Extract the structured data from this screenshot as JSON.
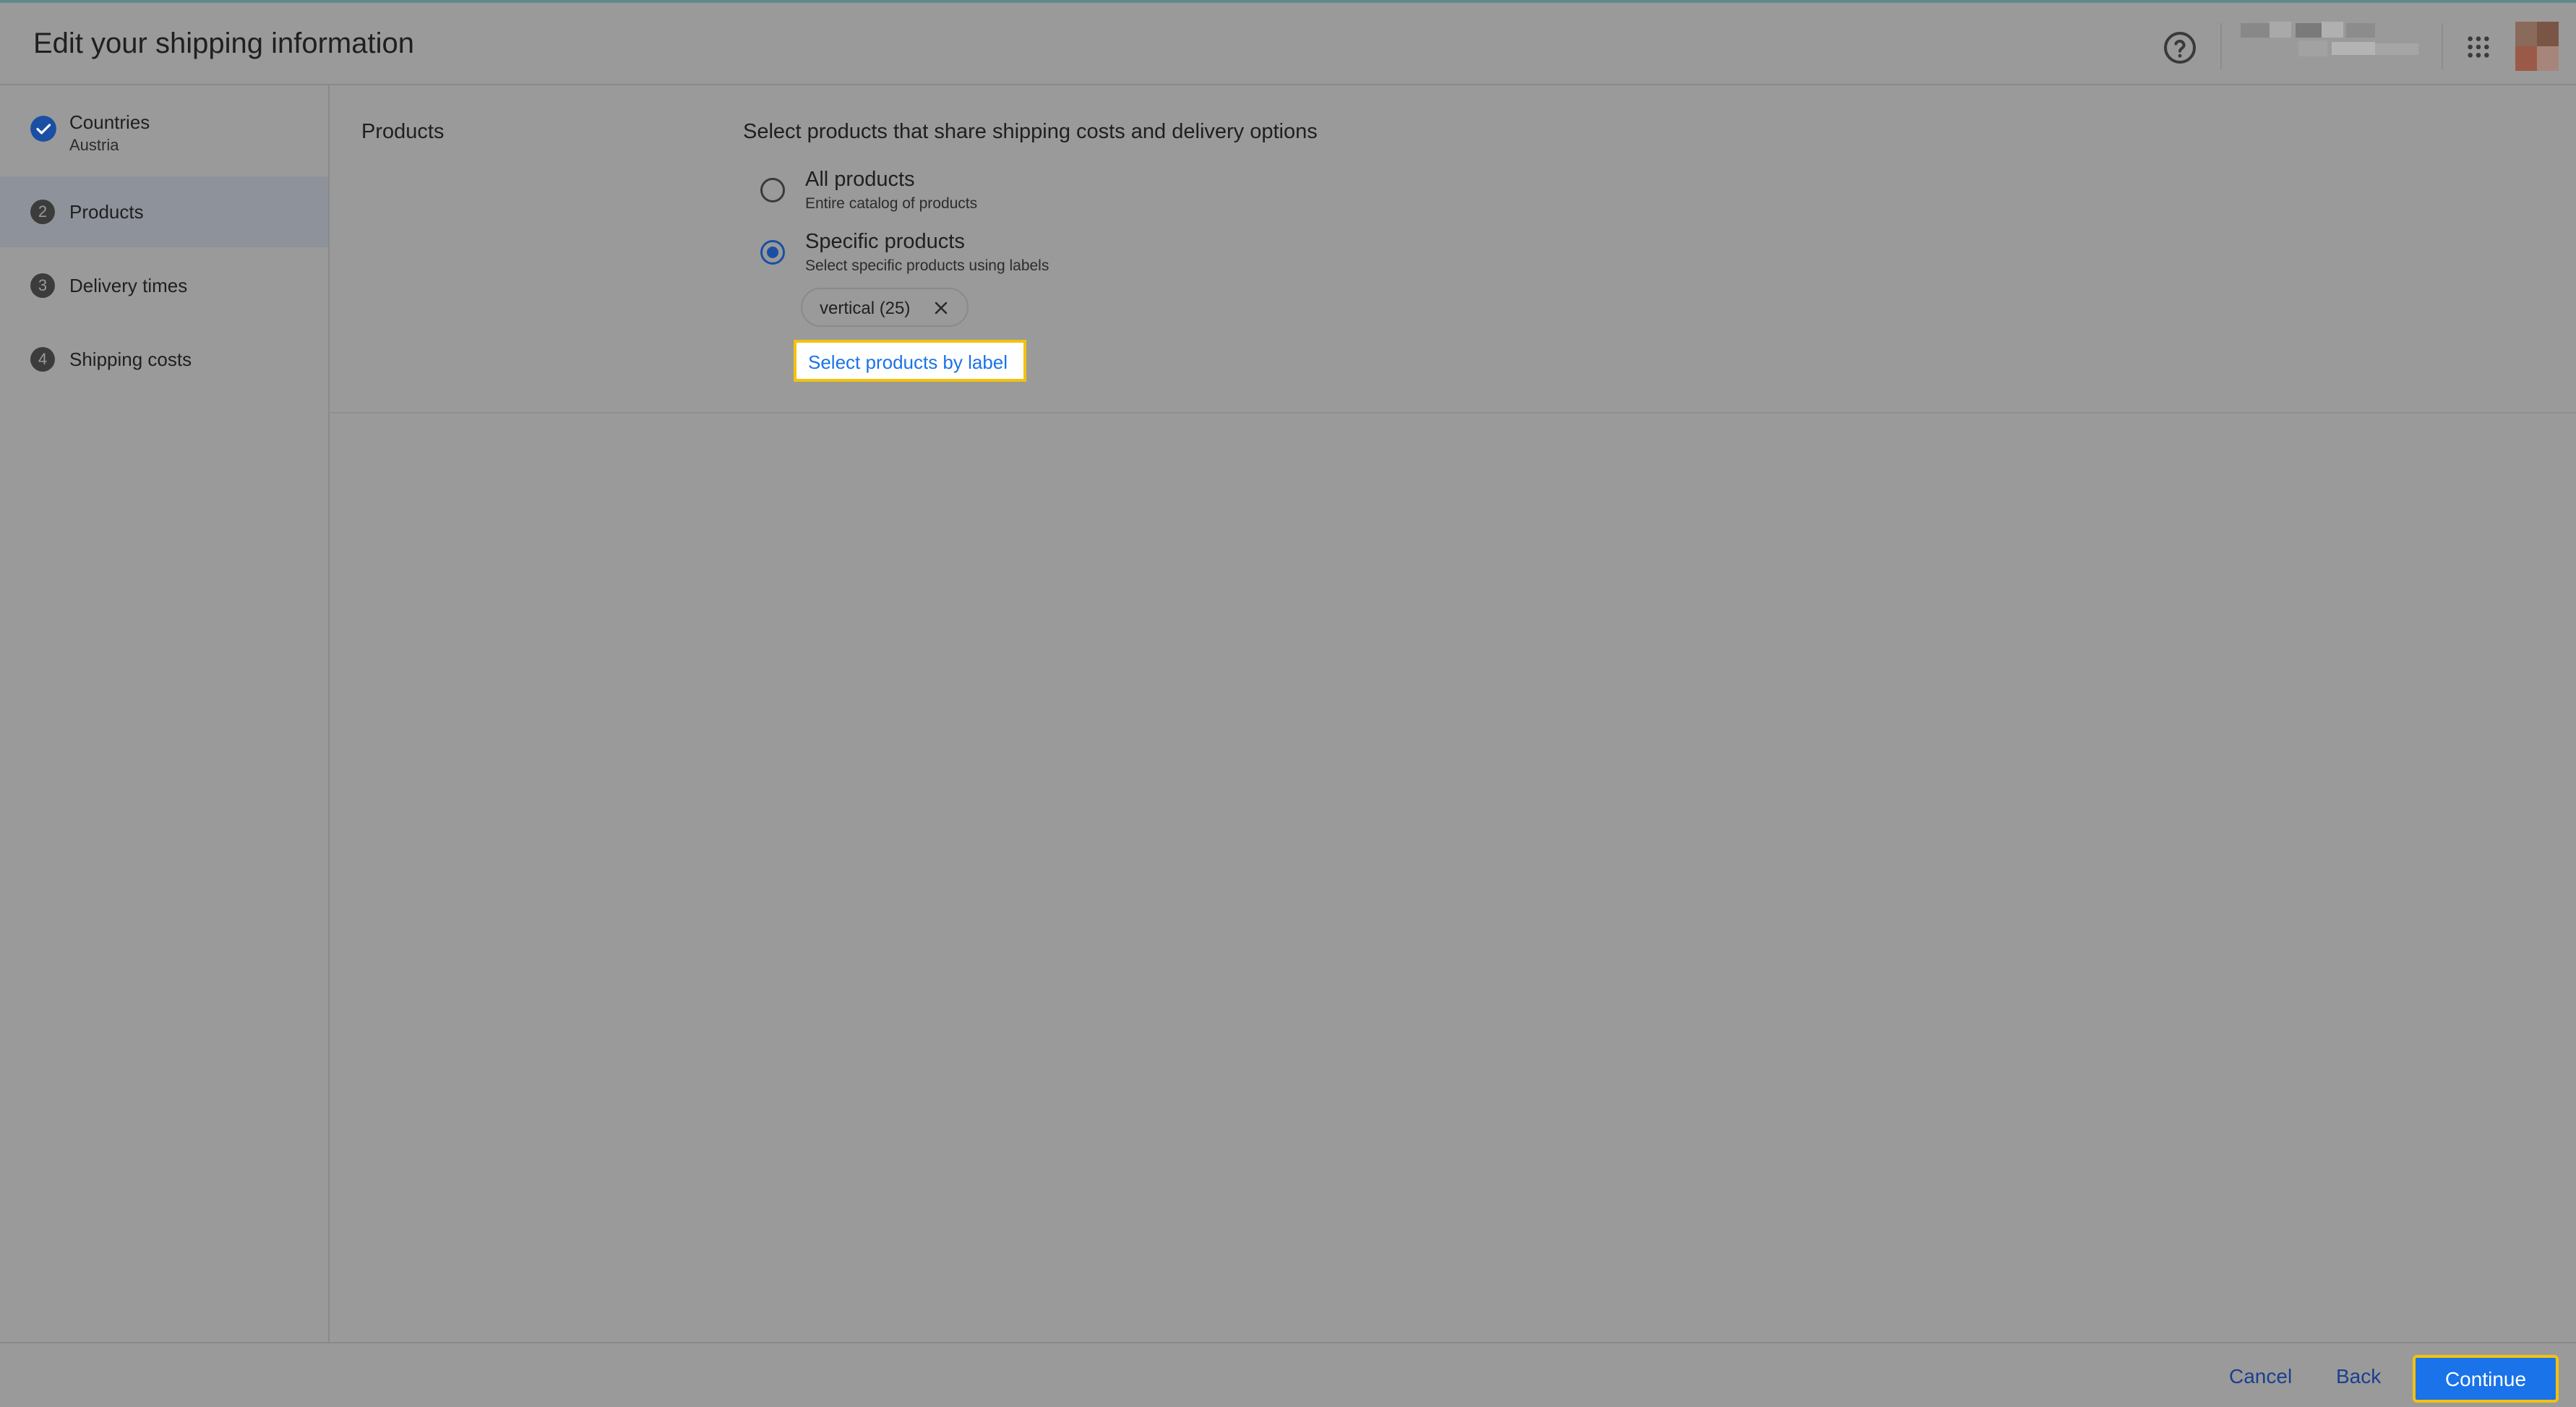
{
  "header": {
    "title": "Edit your shipping information",
    "help_icon": "help-circle-icon",
    "apps_icon": "apps-grid-icon"
  },
  "steps": [
    {
      "number": "",
      "label": "Countries",
      "sublabel": "Austria",
      "state": "done",
      "icon": "check-circle-icon"
    },
    {
      "number": "2",
      "label": "Products",
      "sublabel": "",
      "state": "active"
    },
    {
      "number": "3",
      "label": "Delivery times",
      "sublabel": "",
      "state": "pending"
    },
    {
      "number": "4",
      "label": "Shipping costs",
      "sublabel": "",
      "state": "pending"
    }
  ],
  "main": {
    "section_title": "Products",
    "intro": "Select products that share shipping costs and delivery options",
    "options": [
      {
        "label": "All products",
        "sublabel": "Entire catalog of products",
        "checked": false
      },
      {
        "label": "Specific products",
        "sublabel": "Select specific products using labels",
        "checked": true
      }
    ],
    "chip": {
      "label": "vertical (25)",
      "close_icon": "close-icon"
    },
    "select_by_label": "Select products by label"
  },
  "footer": {
    "cancel": "Cancel",
    "back": "Back",
    "continue": "Continue"
  },
  "colors": {
    "accent": "#1a73e8",
    "highlight": "#f4c20d",
    "overlay": "#9a9a9a"
  }
}
